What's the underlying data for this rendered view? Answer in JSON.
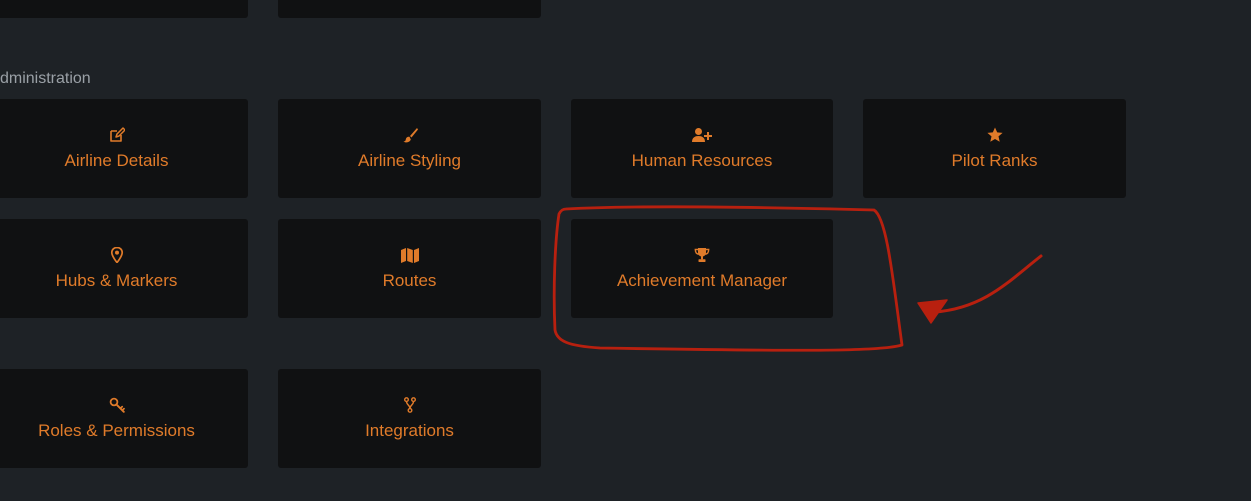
{
  "section": {
    "title": "dministration"
  },
  "tiles": {
    "airline_details": {
      "label": "Airline Details",
      "icon": "edit-icon"
    },
    "airline_styling": {
      "label": "Airline Styling",
      "icon": "paint-brush-icon"
    },
    "human_resources": {
      "label": "Human Resources",
      "icon": "user-plus-icon"
    },
    "pilot_ranks": {
      "label": "Pilot Ranks",
      "icon": "star-icon"
    },
    "hubs_markers": {
      "label": "Hubs & Markers",
      "icon": "map-marker-icon"
    },
    "routes": {
      "label": "Routes",
      "icon": "map-icon"
    },
    "achievement_manager": {
      "label": "Achievement Manager",
      "icon": "trophy-icon"
    },
    "roles_permissions": {
      "label": "Roles & Permissions",
      "icon": "key-icon"
    },
    "integrations": {
      "label": "Integrations",
      "icon": "code-branch-icon"
    }
  },
  "colors": {
    "background": "#1e2226",
    "tile": "#101112",
    "accent": "#e07b2a",
    "section_title": "#9aa0a6",
    "annotation": "#b8200f"
  }
}
